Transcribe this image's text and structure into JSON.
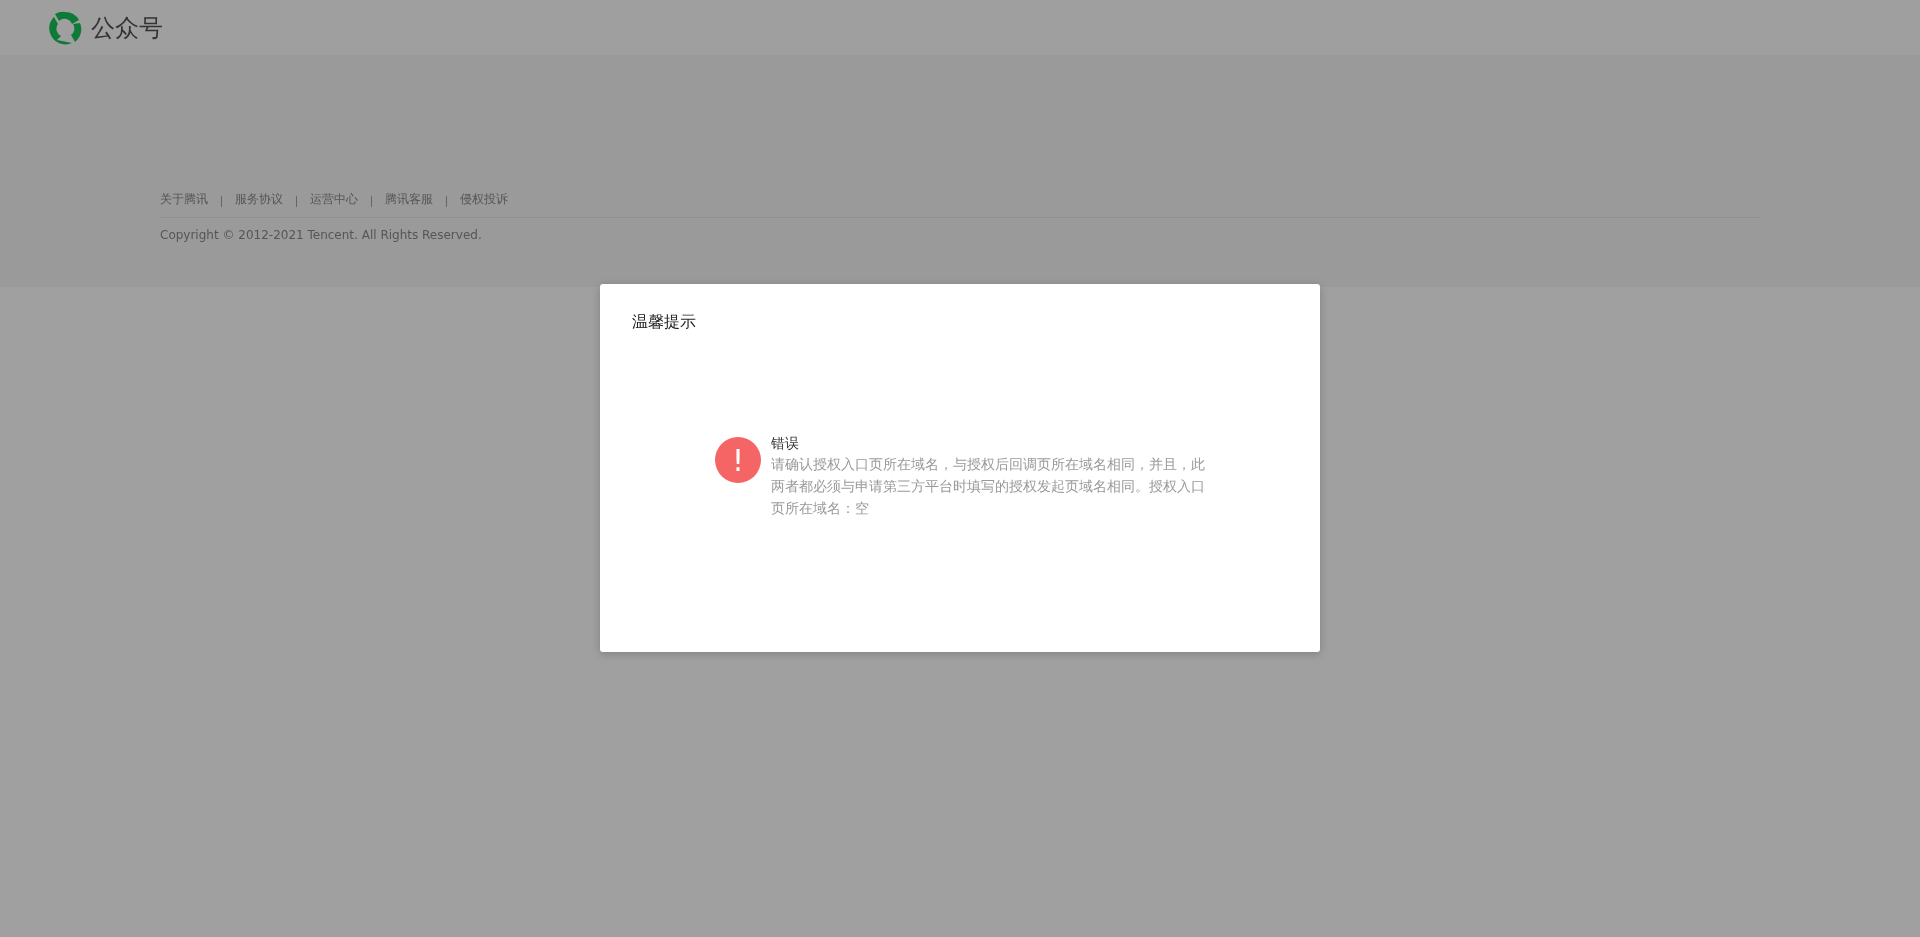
{
  "header": {
    "brand": "公众号"
  },
  "footer": {
    "links": [
      "关于腾讯",
      "服务协议",
      "运营中心",
      "腾讯客服",
      "侵权投诉"
    ],
    "copyright": "Copyright © 2012-2021 Tencent. All Rights Reserved."
  },
  "dialog": {
    "title": "温馨提示",
    "kind": "error",
    "icon": "!",
    "heading": "错误",
    "message": "请确认授权入口页所在域名，与授权后回调页所在域名相同，并且，此两者都必须与申请第三方平台时填写的授权发起页域名相同。授权入口页所在域名：空"
  }
}
